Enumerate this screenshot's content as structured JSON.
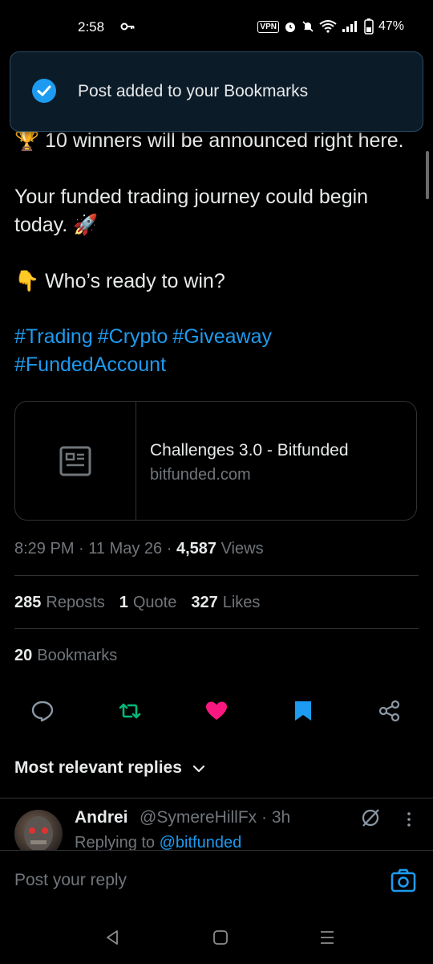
{
  "status_bar": {
    "time": "2:58",
    "vpn": "VPN",
    "battery": "47%"
  },
  "toast": {
    "message": "Post added to your Bookmarks"
  },
  "post": {
    "body": "🏆 10 winners will be announced right here.\n\nYour funded trading journey could begin today. 🚀\n\n👇 Who’s ready to win?",
    "hashtags": [
      "#Trading",
      "#Crypto",
      "#Giveaway",
      "#FundedAccount"
    ],
    "card": {
      "title": "Challenges 3.0 - Bitfunded",
      "domain": "bitfunded.com"
    },
    "time": "8:29 PM",
    "date": "11 May 26",
    "views_count": "4,587",
    "views_label": "Views",
    "reposts_count": "285",
    "reposts_label": "Reposts",
    "quotes_count": "1",
    "quotes_label": "Quote",
    "likes_count": "327",
    "likes_label": "Likes",
    "bookmarks_count": "20",
    "bookmarks_label": "Bookmarks"
  },
  "replies": {
    "sort_label": "Most relevant replies",
    "first": {
      "name": "Andrei",
      "handle": "@SymereHillFx · 3h",
      "replying_prefix": "Replying to",
      "replying_to": "@bitfunded"
    }
  },
  "composer": {
    "placeholder": "Post your reply"
  },
  "colors": {
    "accent": "#1d9bf0",
    "repost": "#00ba7c",
    "like": "#f91880",
    "background": "#000000"
  }
}
